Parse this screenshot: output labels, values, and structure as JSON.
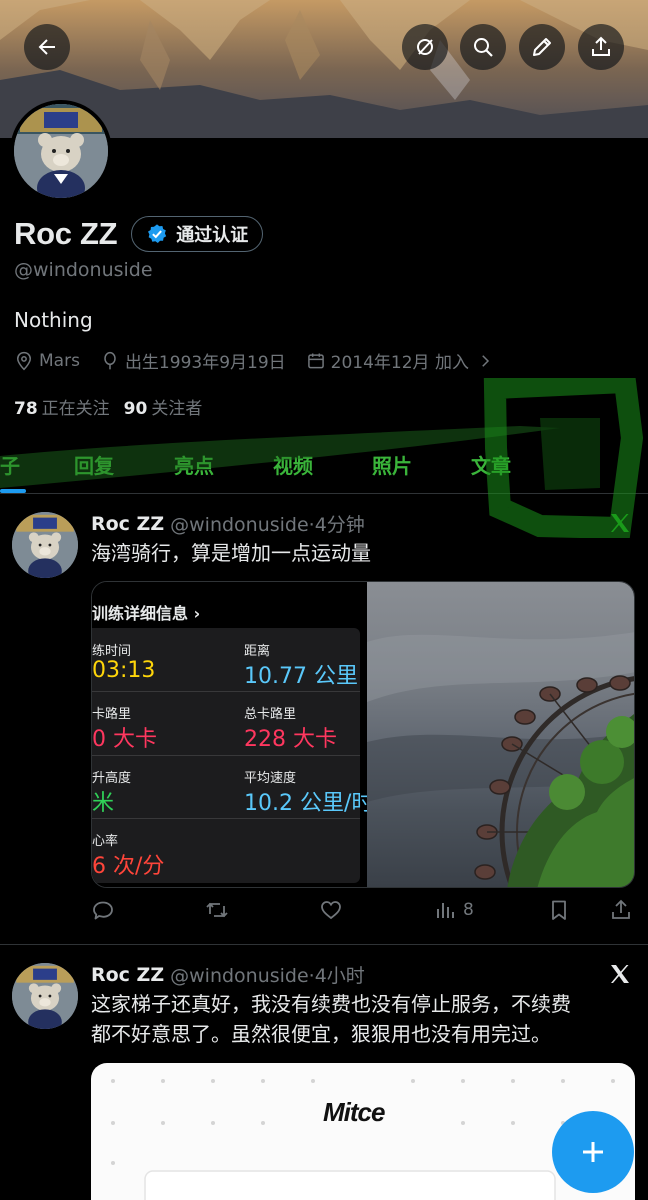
{
  "profile": {
    "display_name": "Roc ZZ",
    "verified_label": "通过认证",
    "handle": "@windonuside",
    "bio": "Nothing",
    "location": "Mars",
    "birth": "出生1993年9月19日",
    "joined": "2014年12月 加入",
    "following_count": "78",
    "following_label": "正在关注",
    "followers_count": "90",
    "followers_label": "关注者"
  },
  "tabs": [
    {
      "label": "子"
    },
    {
      "label": "回复"
    },
    {
      "label": "亮点"
    },
    {
      "label": "视频"
    },
    {
      "label": "照片"
    },
    {
      "label": "文章"
    }
  ],
  "tweets": [
    {
      "name": "Roc ZZ",
      "meta": "@windonuside·4分钟",
      "text": "海湾骑行，算是增加一点运动量",
      "views": "8",
      "fitness": {
        "title": "训练详细信息 ›",
        "cells": [
          {
            "label": "练时间",
            "value": "03:13",
            "color": "#ffd60a"
          },
          {
            "label": "距离",
            "value": "10.77 公里",
            "color": "#5ac8fa"
          },
          {
            "label": "卡路里",
            "value": "0 大卡",
            "color": "#ff375f"
          },
          {
            "label": "总卡路里",
            "value": "228 大卡",
            "color": "#ff375f"
          },
          {
            "label": "升高度",
            "value": "米",
            "color": "#30d158"
          },
          {
            "label": "平均速度",
            "value": "10.2 公里/时",
            "color": "#5ac8fa"
          },
          {
            "label": "心率",
            "value": "6 次/分",
            "color": "#ff453a"
          }
        ]
      }
    },
    {
      "name": "Roc ZZ",
      "meta": "@windonuside·4小时",
      "text_line1": "这家梯子还真好，我没有续费也没有停止服务，不续费",
      "text_line2": "都不好意思了。虽然很便宜，狠狠用也没有用完过。",
      "card_brand": "Mitce"
    }
  ],
  "colors": {
    "accent": "#1d9bf0",
    "tab_green": "#3ab43a",
    "muted": "#71767b"
  }
}
